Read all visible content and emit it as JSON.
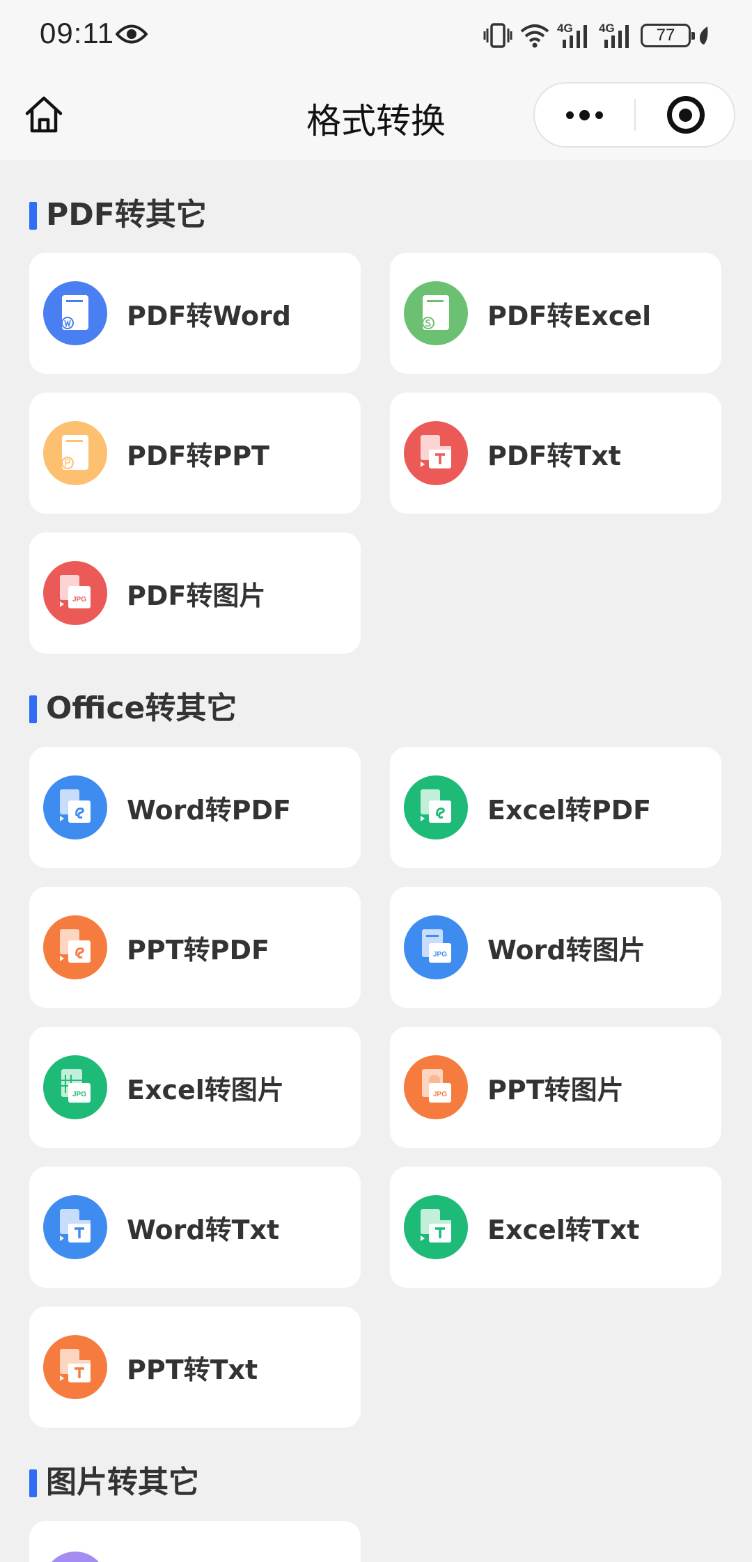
{
  "status_bar": {
    "time": "09:11",
    "network_1": "4G",
    "network_2": "4G",
    "battery": "77"
  },
  "nav": {
    "title": "格式转换"
  },
  "sections": [
    {
      "title": "PDF转其它",
      "items": [
        {
          "label": "PDF转Word",
          "icon": "pdf-to-word-icon",
          "color": "#4a7ff2"
        },
        {
          "label": "PDF转Excel",
          "icon": "pdf-to-excel-icon",
          "color": "#6cc072"
        },
        {
          "label": "PDF转PPT",
          "icon": "pdf-to-ppt-icon",
          "color": "#fdc070"
        },
        {
          "label": "PDF转Txt",
          "icon": "pdf-to-txt-icon",
          "color": "#ec5a58"
        },
        {
          "label": "PDF转图片",
          "icon": "pdf-to-image-icon",
          "color": "#ec5a58"
        }
      ]
    },
    {
      "title": "Office转其它",
      "items": [
        {
          "label": "Word转PDF",
          "icon": "word-to-pdf-icon",
          "color": "#3f8cf0"
        },
        {
          "label": "Excel转PDF",
          "icon": "excel-to-pdf-icon",
          "color": "#1dba78"
        },
        {
          "label": "PPT转PDF",
          "icon": "ppt-to-pdf-icon",
          "color": "#f57c3e"
        },
        {
          "label": "Word转图片",
          "icon": "word-to-image-icon",
          "color": "#3f8cf0"
        },
        {
          "label": "Excel转图片",
          "icon": "excel-to-image-icon",
          "color": "#1dba78"
        },
        {
          "label": "PPT转图片",
          "icon": "ppt-to-image-icon",
          "color": "#f57c3e"
        },
        {
          "label": "Word转Txt",
          "icon": "word-to-txt-icon",
          "color": "#3f8cf0"
        },
        {
          "label": "Excel转Txt",
          "icon": "excel-to-txt-icon",
          "color": "#1dba78"
        },
        {
          "label": "PPT转Txt",
          "icon": "ppt-to-txt-icon",
          "color": "#f57c3e"
        }
      ]
    },
    {
      "title": "图片转其它",
      "items": [
        {
          "label": "",
          "icon": "image-convert-icon",
          "color": "#a48cf0"
        }
      ]
    }
  ]
}
